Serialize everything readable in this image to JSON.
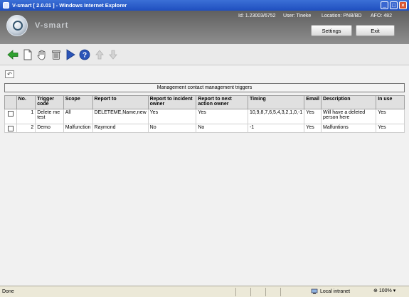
{
  "window": {
    "title": "V-smart [ 2.0.01 ] - Windows Internet Explorer"
  },
  "header": {
    "logo_text": "V-smart",
    "id_label": "Id: 1.23003/6752",
    "user_label": "User: Tineke",
    "location_label": "Location: PNB/BD",
    "afo_label": "AFO: 482",
    "settings_label": "Settings",
    "exit_label": "Exit"
  },
  "toolbar": {
    "icons": [
      "back-arrow-icon",
      "new-document-icon",
      "hand-select-icon",
      "delete-bin-icon",
      "next-arrow-icon",
      "help-icon",
      "move-up-arrow-icon",
      "move-down-arrow-icon"
    ]
  },
  "table": {
    "title": "Management contact management triggers",
    "headers": [
      "",
      "No.",
      "Trigger code",
      "Scope",
      "Report to",
      "Report to incident owner",
      "Report to next action owner",
      "Timing",
      "Email",
      "Description",
      "In use"
    ],
    "rows": [
      {
        "no": "1",
        "trigger_code": "Delete me test",
        "scope": "All",
        "report_to": "DELETEME,Name,new",
        "incident_owner": "Yes",
        "next_action_owner": "Yes",
        "timing": "10,9,8,7,6,5,4,3,2,1,0,-1",
        "email": "Yes",
        "description": "Will have a deleted person here",
        "in_use": "Yes"
      },
      {
        "no": "2",
        "trigger_code": "Demo",
        "scope": "Malfunction",
        "report_to": "Raymond",
        "incident_owner": "No",
        "next_action_owner": "No",
        "timing": "-1",
        "email": "Yes",
        "description": "Malfuntions",
        "in_use": "Yes"
      }
    ]
  },
  "status": {
    "left": "Done",
    "zone": "Local intranet",
    "zoom": "100%"
  }
}
